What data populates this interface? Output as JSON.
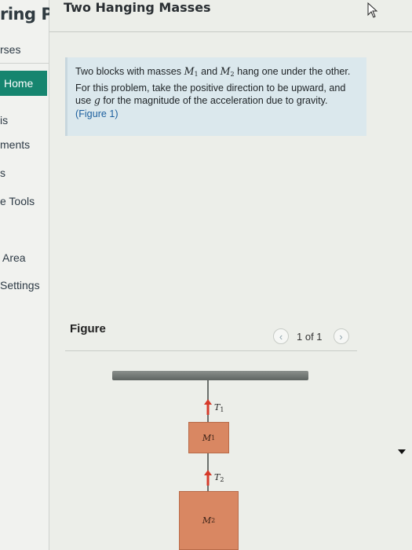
{
  "sidebar": {
    "brand": "ring Pl",
    "items": [
      {
        "label": "rses"
      },
      {
        "label": "Home"
      },
      {
        "label": "is"
      },
      {
        "label": "ments"
      },
      {
        "label": "s"
      },
      {
        "label": "e Tools"
      },
      {
        "label": "Area"
      },
      {
        "label": "Settings"
      }
    ]
  },
  "header": {
    "title": "Two Hanging Masses"
  },
  "problem": {
    "text_before": "Two blocks with masses ",
    "m1": "M",
    "m1_sub": "1",
    "text_and": " and ",
    "m2": "M",
    "m2_sub": "2",
    "text_after": " hang one under the other. For this problem, take the positive direction to be upward, and use ",
    "g": "g",
    "text_end": " for the magnitude of the acceleration due to gravity. ",
    "figure_link": "(Figure 1)"
  },
  "figure": {
    "label": "Figure",
    "pager_text": "1 of 1",
    "prev_icon": "chevron-left-icon",
    "next_icon": "chevron-right-icon",
    "t1": "T",
    "t1_sub": "1",
    "t2": "T",
    "t2_sub": "2",
    "block1": "M",
    "block1_sub": "1",
    "block2": "M",
    "block2_sub": "2"
  },
  "colors": {
    "accent": "#16856f",
    "problem_bg": "#dbe8ed",
    "block": "#d98762",
    "arrow": "#d63a2a"
  }
}
